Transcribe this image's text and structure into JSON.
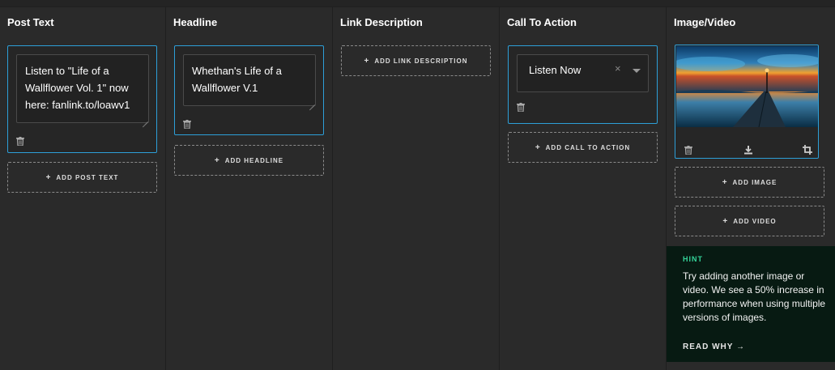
{
  "columns": {
    "post_text": {
      "title": "Post Text",
      "value": "Listen to \"Life of a Wallflower Vol. 1\" now here: fanlink.to/loawv1",
      "add_label": "ADD POST TEXT"
    },
    "headline": {
      "title": "Headline",
      "value": "Whethan's Life of a Wallflower V.1",
      "add_label": "ADD HEADLINE"
    },
    "link_description": {
      "title": "Link Description",
      "add_label": "ADD LINK DESCRIPTION"
    },
    "call_to_action": {
      "title": "Call To Action",
      "selected": "Listen Now",
      "clear_glyph": "×",
      "add_label": "ADD CALL TO ACTION"
    },
    "image_video": {
      "title": "Image/Video",
      "add_image_label": "ADD IMAGE",
      "add_video_label": "ADD VIDEO"
    }
  },
  "plus_glyph": "+",
  "hint": {
    "title": "HINT",
    "body": "Try adding another image or video. We see a 50% increase in performance when using multiple versions of images.",
    "link": "READ WHY →"
  },
  "icons": {
    "delete": "trash-icon",
    "download": "download-icon",
    "crop": "crop-icon",
    "clear": "clear-icon",
    "dropdown": "chevron-down-icon"
  },
  "colors": {
    "background": "#2a2a2a",
    "accent": "#2d9fd8",
    "hint_bg": "#071a12",
    "hint_title": "#34d399"
  }
}
